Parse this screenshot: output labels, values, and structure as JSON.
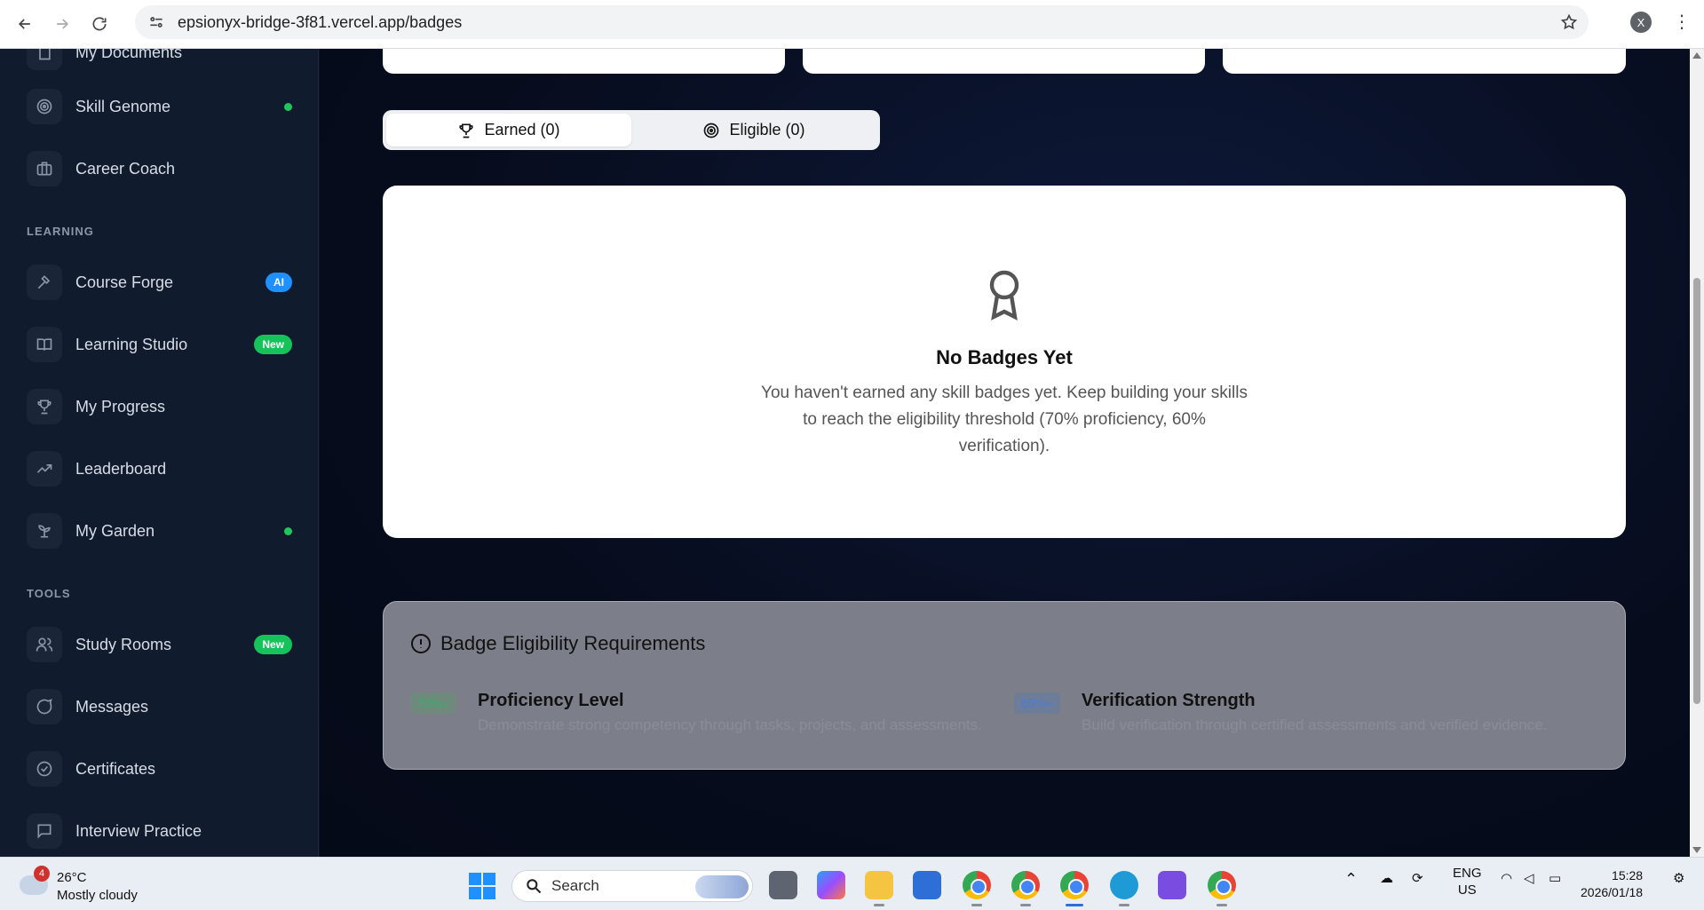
{
  "browser": {
    "url": "epsionyx-bridge-3f81.vercel.app/badges",
    "profile_initial": "X"
  },
  "sidebar": {
    "partial_item": "My Documents",
    "items": [
      {
        "label": "Skill Genome",
        "indicator": "dot"
      },
      {
        "label": "Career Coach"
      }
    ],
    "sections": [
      {
        "title": "LEARNING",
        "items": [
          {
            "label": "Course Forge",
            "badge": "AI"
          },
          {
            "label": "Learning Studio",
            "badge": "New"
          },
          {
            "label": "My Progress"
          },
          {
            "label": "Leaderboard"
          },
          {
            "label": "My Garden",
            "indicator": "dot"
          }
        ]
      },
      {
        "title": "TOOLS",
        "items": [
          {
            "label": "Study Rooms",
            "badge": "New"
          },
          {
            "label": "Messages"
          },
          {
            "label": "Certificates"
          },
          {
            "label": "Interview Practice"
          }
        ]
      }
    ]
  },
  "tabs": [
    {
      "label": "Earned (0)",
      "icon": "trophy-icon",
      "active": true
    },
    {
      "label": "Eligible (0)",
      "icon": "target-icon",
      "active": false
    }
  ],
  "empty_state": {
    "title": "No Badges Yet",
    "message": "You haven't earned any skill badges yet. Keep building your skills to reach the eligibility threshold (70% proficiency, 60% verification)."
  },
  "requirements": {
    "title": "Badge Eligibility Requirements",
    "items": [
      {
        "pill": "70%+",
        "name": "Proficiency Level",
        "description": "Demonstrate strong competency through tasks, projects, and assessments."
      },
      {
        "pill": "60%+",
        "name": "Verification Strength",
        "description": "Build verification through certified assessments and verified evidence."
      }
    ]
  },
  "taskbar": {
    "weather_badge": "4",
    "temperature": "26°C",
    "condition": "Mostly cloudy",
    "search_placeholder": "Search",
    "language": "ENG",
    "region": "US",
    "time": "15:28",
    "date": "2026/01/18"
  },
  "colors": {
    "sidebar_bg": "#101b2e",
    "main_bg": "#070c1d",
    "badge_ai": "#1e90ff",
    "badge_new": "#16c25a",
    "indicator_dot": "#22c55e"
  }
}
